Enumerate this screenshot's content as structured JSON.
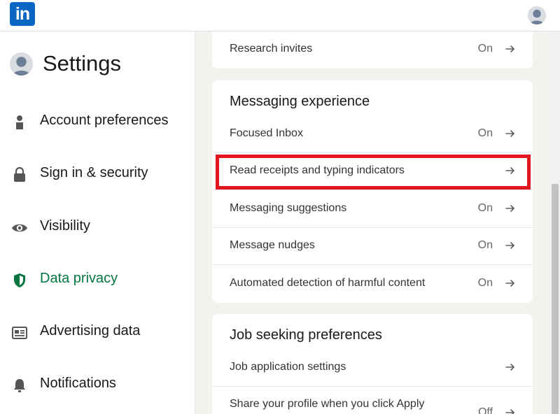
{
  "header": {
    "logo_text": "in",
    "colors": {
      "brand": "#0a66c2"
    }
  },
  "sidebar": {
    "title": "Settings",
    "items": [
      {
        "label": "Account preferences",
        "icon": "person-icon",
        "active": false
      },
      {
        "label": "Sign in & security",
        "icon": "lock-icon",
        "active": false
      },
      {
        "label": "Visibility",
        "icon": "eye-icon",
        "active": false
      },
      {
        "label": "Data privacy",
        "icon": "shield-icon",
        "active": true
      },
      {
        "label": "Advertising data",
        "icon": "newspaper-icon",
        "active": false
      },
      {
        "label": "Notifications",
        "icon": "bell-icon",
        "active": false
      }
    ],
    "active_color": "#057642"
  },
  "main": {
    "partial_card": {
      "rows": [
        {
          "label": "Research invites",
          "status": "On"
        }
      ]
    },
    "messaging": {
      "title": "Messaging experience",
      "rows": [
        {
          "label": "Focused Inbox",
          "status": "On"
        },
        {
          "label": "Read receipts and typing indicators",
          "status": ""
        },
        {
          "label": "Messaging suggestions",
          "status": "On"
        },
        {
          "label": "Message nudges",
          "status": "On"
        },
        {
          "label": "Automated detection of harmful content",
          "status": "On"
        }
      ]
    },
    "job_seeking": {
      "title": "Job seeking preferences",
      "rows": [
        {
          "label": "Job application settings",
          "status": ""
        },
        {
          "label": "Share your profile when you click Apply",
          "status": "Off"
        }
      ]
    },
    "highlight_color": "#e3161f"
  }
}
